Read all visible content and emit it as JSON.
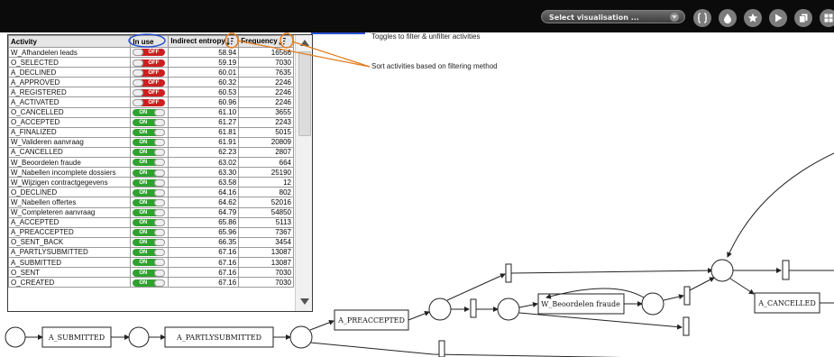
{
  "toolbar": {
    "select_label": "Select visualisation ...",
    "buttons": [
      "braces-icon",
      "drop-icon",
      "star-icon",
      "play-icon",
      "copy-icon",
      "grid-icon"
    ]
  },
  "annotations": {
    "toggle_note": "Toggles to filter & unfilter activities",
    "sort_note": "Sort activities based on filtering method"
  },
  "table": {
    "headers": [
      "Activity",
      "In use",
      "Indirect entropy",
      "Frequency"
    ],
    "toggle_on": "ON",
    "toggle_off": "OFF",
    "rows": [
      {
        "name": "W_Afhandelen leads",
        "on": false,
        "entropy": "58.94",
        "freq": "16566"
      },
      {
        "name": "O_SELECTED",
        "on": false,
        "entropy": "59.19",
        "freq": "7030"
      },
      {
        "name": "A_DECLINED",
        "on": false,
        "entropy": "60.01",
        "freq": "7635"
      },
      {
        "name": "A_APPROVED",
        "on": false,
        "entropy": "60.32",
        "freq": "2246"
      },
      {
        "name": "A_REGISTERED",
        "on": false,
        "entropy": "60.53",
        "freq": "2246"
      },
      {
        "name": "A_ACTIVATED",
        "on": false,
        "entropy": "60.96",
        "freq": "2246"
      },
      {
        "name": "O_CANCELLED",
        "on": true,
        "entropy": "61.10",
        "freq": "3655"
      },
      {
        "name": "O_ACCEPTED",
        "on": true,
        "entropy": "61.27",
        "freq": "2243"
      },
      {
        "name": "A_FINALIZED",
        "on": true,
        "entropy": "61.81",
        "freq": "5015"
      },
      {
        "name": "W_Valideren aanvraag",
        "on": true,
        "entropy": "61.91",
        "freq": "20809"
      },
      {
        "name": "A_CANCELLED",
        "on": true,
        "entropy": "62.23",
        "freq": "2807"
      },
      {
        "name": "W_Beoordelen fraude",
        "on": true,
        "entropy": "63.02",
        "freq": "664"
      },
      {
        "name": "W_Nabellen incomplete dossiers",
        "on": true,
        "entropy": "63.30",
        "freq": "25190"
      },
      {
        "name": "W_Wijzigen contractgegevens",
        "on": true,
        "entropy": "63.58",
        "freq": "12"
      },
      {
        "name": "O_DECLINED",
        "on": true,
        "entropy": "64.16",
        "freq": "802"
      },
      {
        "name": "W_Nabellen offertes",
        "on": true,
        "entropy": "64.62",
        "freq": "52016"
      },
      {
        "name": "W_Completeren aanvraag",
        "on": true,
        "entropy": "64.79",
        "freq": "54850"
      },
      {
        "name": "A_ACCEPTED",
        "on": true,
        "entropy": "65.86",
        "freq": "5113"
      },
      {
        "name": "A_PREACCEPTED",
        "on": true,
        "entropy": "65.96",
        "freq": "7367"
      },
      {
        "name": "O_SENT_BACK",
        "on": true,
        "entropy": "66.35",
        "freq": "3454"
      },
      {
        "name": "A_PARTLYSUBMITTED",
        "on": true,
        "entropy": "67.16",
        "freq": "13087"
      },
      {
        "name": "A_SUBMITTED",
        "on": true,
        "entropy": "67.16",
        "freq": "13087"
      },
      {
        "name": "O_SENT",
        "on": true,
        "entropy": "67.16",
        "freq": "7030"
      },
      {
        "name": "O_CREATED",
        "on": true,
        "entropy": "67.16",
        "freq": "7030"
      }
    ]
  },
  "diagram": {
    "labels": [
      "A_SUBMITTED",
      "A_PARTLYSUBMITTED",
      "A_PREACCEPTED",
      "W_Beoordelen fraude",
      "A_CANCELLED"
    ]
  },
  "colors": {
    "toggle_on": "#2fa12f",
    "toggle_off": "#cc1f1f",
    "annotation_line": "#e07b1c",
    "highlight_ring": "#2a4fd1"
  }
}
